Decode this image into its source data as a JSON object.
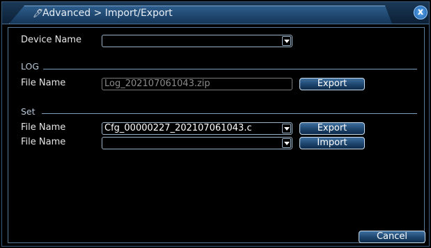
{
  "window": {
    "title": "Advanced > Import/Export",
    "close_label": "x"
  },
  "device": {
    "label": "Device Name",
    "value": ""
  },
  "log": {
    "section": "LOG",
    "file_label": "File Name",
    "file_value": "Log_202107061043.zip",
    "export_label": "Export"
  },
  "set": {
    "section": "Set",
    "export_file_label": "File Name",
    "export_file_value": "Cfg_00000227_202107061043.c",
    "export_label": "Export",
    "import_file_label": "File Name",
    "import_file_value": "",
    "import_label": "Import"
  },
  "footer": {
    "cancel_label": "Cancel"
  },
  "colors": {
    "background": "#000000",
    "accent": "#2d5d8c",
    "section_line": "#7fa0be"
  },
  "icons": {
    "title": "cursor-icon",
    "close": "close-icon",
    "dropdown": "chevron-down-icon"
  }
}
